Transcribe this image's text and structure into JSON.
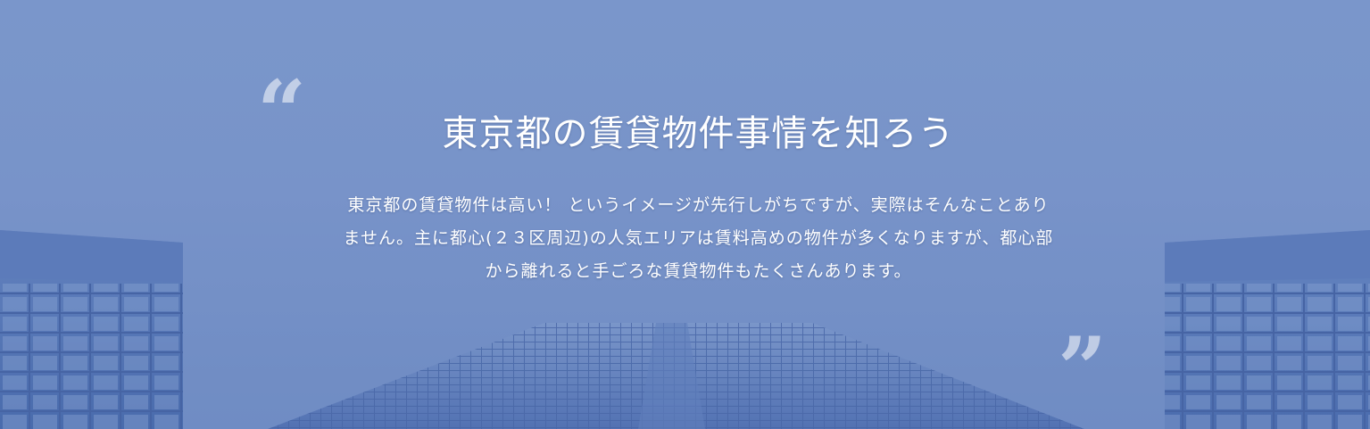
{
  "hero": {
    "title": "東京都の賃貸物件事情を知ろう",
    "body": "東京都の賃貸物件は高い！ というイメージが先行しがちですが、実際はそんなことありません。主に都心(２３区周辺)の人気エリアは賃料高めの物件が多くなりますが、都心部から離れると手ごろな賃貸物件もたくさんあります。",
    "quote_open": "“",
    "quote_close": "”",
    "colors": {
      "overlay": "#7a97cb",
      "text": "#ffffff"
    }
  }
}
